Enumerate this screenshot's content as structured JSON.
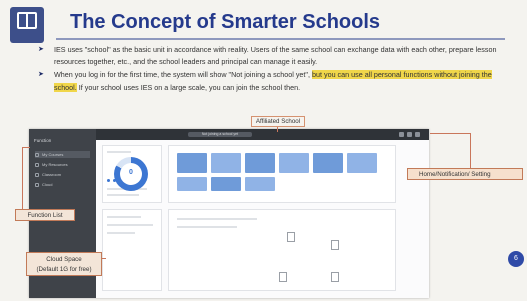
{
  "logo": {
    "caption": ""
  },
  "title": "The Concept of Smarter Schools",
  "bullets": [
    {
      "text": "IES uses \"school\" as the basic unit in accordance with reality. Users of the same school can exchange data with each other, prepare lesson resources together, etc., and the school leaders and principal can manage it easily.",
      "pre": "",
      "highlight": "",
      "post": ""
    },
    {
      "text": "",
      "pre": "When you log in for the first time, the system will show \"Not joining a school yet\", ",
      "highlight": "but you can use all personal functions without joining the school.",
      "post": " If your school uses IES on a large scale, you can join the school then."
    }
  ],
  "labels": {
    "affiliated_school": "Affiliated School",
    "home": "Home/Notification/ Setting",
    "function_list": "Function List",
    "cloud_space_line1": "Cloud Space",
    "cloud_space_line2": "(Default 1G for free)"
  },
  "screenshot": {
    "sidebar_brand": "Function",
    "sidebar_items": [
      "My Courses",
      "My Resources",
      "Classroom",
      "Cloud"
    ],
    "topbar_center": "Not joining a school yet",
    "ring_value": "0"
  },
  "page_number": "6"
}
